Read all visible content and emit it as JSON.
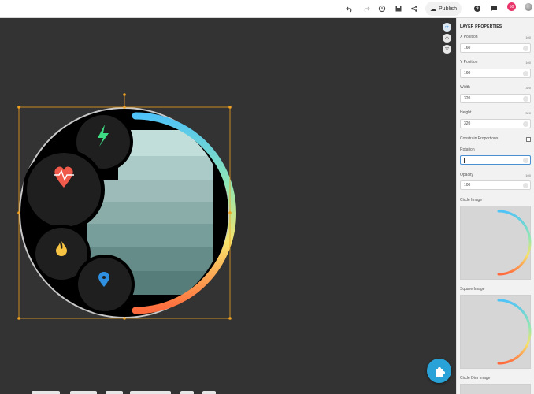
{
  "topbar": {
    "publish_label": "Publish",
    "notification_count": "50",
    "icons": [
      "undo-icon",
      "redo-icon",
      "history-icon",
      "save-icon",
      "share-icon",
      "cloud-icon",
      "help-icon",
      "chat-icon",
      "avatar"
    ]
  },
  "canvas_tools": [
    "pin-icon",
    "compass-icon",
    "layers-icon"
  ],
  "panel": {
    "title": "LAYER PROPERTIES",
    "x_label": "X Position",
    "x_unit": "100",
    "x_value": "160",
    "y_label": "Y Position",
    "y_unit": "100",
    "y_value": "160",
    "w_label": "Width",
    "w_unit": "320",
    "w_value": "320",
    "h_label": "Height",
    "h_unit": "320",
    "h_value": "320",
    "constrain_label": "Constrain Proportions",
    "rotation_label": "Rotation",
    "rotation_value": "",
    "opacity_label": "Opacity",
    "opacity_unit": "100",
    "opacity_value": "100",
    "circle_image_label": "Circle Image",
    "square_image_label": "Square Image",
    "circle_dim_image_label": "Circle Dim Image"
  },
  "colors": {
    "canvas_bg": "#333333",
    "accent_blue": "#29a3d7",
    "selection": "#f0a020",
    "heart_red": "#f05a4b",
    "bolt_green": "#3ddc84",
    "flame_yellow": "#f6c343",
    "pin_blue": "#2f8fe0"
  }
}
